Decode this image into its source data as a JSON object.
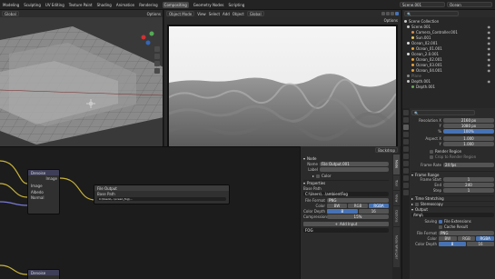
{
  "topbar": {
    "menus": [
      "Modeling",
      "Sculpting",
      "UV Editing",
      "Texture Paint",
      "Shading",
      "Animation",
      "Rendering",
      "Compositing",
      "Geometry Nodes",
      "Scripting"
    ],
    "active_menu": "Compositing",
    "scene": "Scene.001",
    "view_layer": "Ocean"
  },
  "viewport": {
    "orientation_label": "Global",
    "options": "Options"
  },
  "render": {
    "mode": "Object Mode",
    "menus": [
      "View",
      "Select",
      "Add",
      "Object"
    ],
    "orientation": "Global",
    "options": "Options"
  },
  "outliner": {
    "items": [
      {
        "label": "Scene Collection",
        "color": "#c8c8c8"
      },
      {
        "label": "Scene.001",
        "color": "#c8c8c8"
      },
      {
        "label": "Camera_Controller.001",
        "color": "#d18b50"
      },
      {
        "label": "Sun.001",
        "color": "#e7c75a"
      },
      {
        "label": "Ocean_02.001",
        "color": "#e0e0e0"
      },
      {
        "label": "Ocean_01.001",
        "color": "#e6a03a"
      },
      {
        "label": "Ocean_2.0.001",
        "color": "#e0e0e0"
      },
      {
        "label": "Ocean_02.001",
        "color": "#e6a03a"
      },
      {
        "label": "Ocean_03.001",
        "color": "#e6a03a"
      },
      {
        "label": "Ocean_04.001",
        "color": "#e6a03a"
      },
      {
        "label": "Plane",
        "color": "#c8c8c8"
      },
      {
        "label": "Depth.001",
        "color": "#c8c8c8"
      },
      {
        "label": "Depth.001",
        "color": "#6aa85a"
      }
    ]
  },
  "props": {
    "resolution_x_label": "Resolution X",
    "resolution_x": "2160 px",
    "resolution_y_label": "Y",
    "resolution_y": "1080 px",
    "percent_label": "%",
    "percent": "100%",
    "aspect_x_label": "Aspect X",
    "aspect_x": "1.000",
    "aspect_y_label": "Y",
    "aspect_y": "1.000",
    "render_region": "Render Region",
    "crop": "Crop to Render Region",
    "frame_rate_label": "Frame Rate",
    "frame_rate": "24 fps",
    "frame_range": "Frame Range",
    "frame_start_label": "Frame Start",
    "frame_start": "1",
    "end_label": "End",
    "end": "240",
    "step_label": "Step",
    "step": "1",
    "time_stretching": "Time Stretching",
    "stereoscopy": "Stereoscopy",
    "output": "Output",
    "output_path": "/tmp\\",
    "saving_label": "Saving",
    "file_extensions": "File Extensions",
    "cache_result": "Cache Result",
    "file_format_label": "File Format",
    "file_format": "PNG",
    "color_label": "Color",
    "color_options": [
      "BW",
      "RGB",
      "RGBA"
    ],
    "color_depth_label": "Color Depth",
    "color_depth_options": [
      "8",
      "16"
    ]
  },
  "nodes": {
    "denoise1_title": "Denoise",
    "denoise1_rows": [
      "Image",
      "Image",
      "Albedo",
      "Normal"
    ],
    "denoise1_output": "Image",
    "fileout_title": "File Output",
    "fileout_path": "Base Path",
    "fileout_value": "C:\\Users\\...\\ocean_fog\\...",
    "denoise2_title": "Denoise"
  },
  "npanel": {
    "header": "Backdrop",
    "node": "Node",
    "name_label": "Name",
    "name": "File Output.001",
    "label_label": "Label",
    "color": "Color",
    "properties": "Properties",
    "base_path_label": "Base Path",
    "base_path": "C:\\Users\\...\\ambientFog",
    "file_format_label": "File Format",
    "file_format": "PNG",
    "color_label": "Color",
    "color_options": [
      "BW",
      "RGB",
      "RGBA"
    ],
    "color_depth_label": "Color Depth",
    "color_depth_options": [
      "8",
      "16"
    ],
    "compression_label": "Compression",
    "compression": "15%",
    "add_input": "Add Input",
    "input_item": "FOG"
  },
  "vtabs": [
    "Node",
    "Tool",
    "View",
    "Options",
    "Node Wrangler"
  ],
  "colors": {
    "accent": "#4772b3",
    "header": "#2b2b2b",
    "panel": "#2b2b2b"
  }
}
